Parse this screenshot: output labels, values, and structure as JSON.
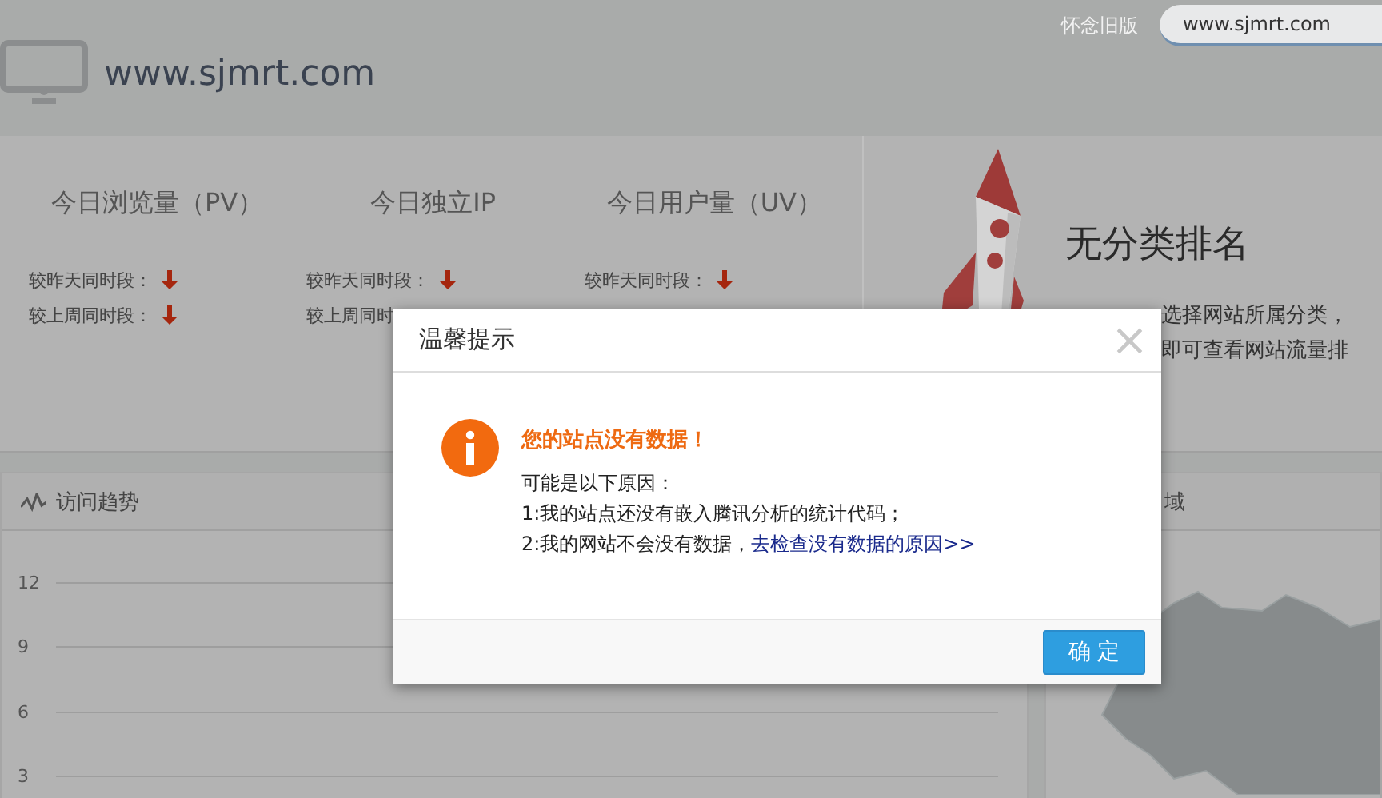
{
  "header": {
    "title": "www.sjmrt.com",
    "old_version_link": "怀念旧版",
    "site_selector": "www.sjmrt.com"
  },
  "stats": [
    {
      "title": "今日浏览量（PV）",
      "rows": [
        {
          "label": "较昨天同时段：",
          "declining": true
        },
        {
          "label": "较上周同时段：",
          "declining": true
        }
      ]
    },
    {
      "title": "今日独立IP",
      "rows": [
        {
          "label": "较昨天同时段：",
          "declining": true
        },
        {
          "label": "较上周同时"
        }
      ]
    },
    {
      "title": "今日用户量（UV）",
      "rows": [
        {
          "label": "较昨天同时段：",
          "declining": true
        }
      ]
    }
  ],
  "ranking": {
    "title": "无分类排名",
    "lines": [
      "选择网站所属分类，",
      "即可查看网站流量排"
    ]
  },
  "trend_panel": {
    "title": "访问趋势",
    "y_ticks": [
      "12",
      "9",
      "6",
      "3"
    ]
  },
  "region_panel": {
    "title": "域"
  },
  "dialog": {
    "title": "温馨提示",
    "close": "×",
    "heading": "您的站点没有数据！",
    "lines": [
      {
        "text": "可能是以下原因："
      },
      {
        "text": "1:我的站点还没有嵌入腾讯分析的统计代码；"
      },
      {
        "text": "2:我的网站不会没有数据，",
        "link": "去检查没有数据的原因>>"
      }
    ],
    "ok_button": "确 定"
  }
}
